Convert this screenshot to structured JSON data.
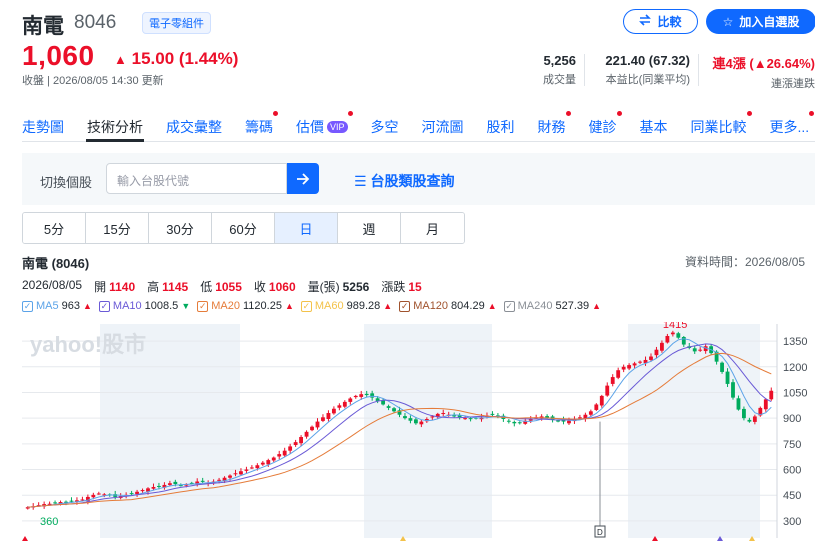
{
  "header": {
    "name": "南電",
    "code": "8046",
    "tag": "電子零組件",
    "compare_label": "比較",
    "watchlist_label": "加入自選股",
    "price": "1,060",
    "change": "15.00 (1.44%)",
    "close_time": "收盤 | 2026/08/05 14:30 更新"
  },
  "stats": [
    {
      "value": "5,256",
      "label": "成交量"
    },
    {
      "value": "221.40 (67.32)",
      "label": "本益比(同業平均)"
    },
    {
      "value": "連4漲 (▲26.64%)",
      "label": "連漲連跌"
    }
  ],
  "tabs": [
    {
      "label": "走勢圖",
      "dot": false
    },
    {
      "label": "技術分析",
      "dot": false
    },
    {
      "label": "成交彙整",
      "dot": false
    },
    {
      "label": "籌碼",
      "dot": true
    },
    {
      "label": "估價",
      "dot": true,
      "vip": "VIP"
    },
    {
      "label": "多空",
      "dot": false
    },
    {
      "label": "河流圖",
      "dot": false
    },
    {
      "label": "股利",
      "dot": false
    },
    {
      "label": "財務",
      "dot": true
    },
    {
      "label": "健診",
      "dot": true
    },
    {
      "label": "基本",
      "dot": false
    },
    {
      "label": "同業比較",
      "dot": true
    },
    {
      "label": "更多...",
      "dot": true
    }
  ],
  "switcher": {
    "label": "切換個股",
    "placeholder": "輸入台股代號",
    "category_link": "台股類股查詢"
  },
  "periods": [
    "5分",
    "15分",
    "30分",
    "60分",
    "日",
    "週",
    "月"
  ],
  "active_period": "日",
  "chart_info": {
    "title": "南電 (8046)",
    "data_time": "資料時間：2026/08/05",
    "date": "2026/08/05",
    "open_label": "開",
    "open": "1140",
    "high_label": "高",
    "high": "1145",
    "low_label": "低",
    "low": "1055",
    "close_label": "收",
    "close": "1060",
    "volume_label": "量(張)",
    "volume": "5256",
    "change_label": "漲跌",
    "change": "15"
  },
  "ma_legend": [
    {
      "name": "MA5",
      "value": "963",
      "dir": "up",
      "color": "#5ba3e8"
    },
    {
      "name": "MA10",
      "value": "1008.5",
      "dir": "down",
      "color": "#6a5ad6"
    },
    {
      "name": "MA20",
      "value": "1120.25",
      "dir": "up",
      "color": "#e57c3a"
    },
    {
      "name": "MA60",
      "value": "989.28",
      "dir": "up",
      "color": "#f3c24a"
    },
    {
      "name": "MA120",
      "value": "804.29",
      "dir": "up",
      "color": "#a0522d"
    },
    {
      "name": "MA240",
      "value": "527.39",
      "dir": "up",
      "color": "#8a8f96"
    }
  ],
  "colors": {
    "up": "#eb0f29",
    "down": "#00ab5e",
    "accent": "#0f69ff"
  },
  "chart_data": {
    "type": "candlestick",
    "watermark": "yahoo!股市",
    "y_ticks": [
      300,
      450,
      600,
      750,
      900,
      1050,
      1200,
      1350
    ],
    "ylim": [
      200,
      1450
    ],
    "annotations": {
      "max_label": "1415",
      "min_label": "360",
      "marker": "D"
    },
    "close_series": [
      380,
      385,
      392,
      398,
      400,
      405,
      410,
      408,
      415,
      420,
      425,
      440,
      452,
      460,
      455,
      448,
      440,
      445,
      452,
      460,
      470,
      480,
      490,
      498,
      502,
      510,
      520,
      515,
      508,
      512,
      520,
      530,
      528,
      522,
      530,
      540,
      552,
      565,
      578,
      590,
      600,
      612,
      625,
      640,
      655,
      670,
      690,
      710,
      735,
      760,
      790,
      820,
      850,
      880,
      905,
      930,
      955,
      975,
      995,
      1015,
      1030,
      1040,
      1035,
      1020,
      1000,
      980,
      960,
      940,
      920,
      900,
      885,
      870,
      880,
      895,
      910,
      925,
      930,
      920,
      910,
      905,
      900,
      895,
      900,
      905,
      915,
      920,
      910,
      895,
      880,
      870,
      875,
      885,
      895,
      905,
      910,
      900,
      890,
      885,
      880,
      885,
      895,
      905,
      920,
      940,
      980,
      1030,
      1090,
      1140,
      1180,
      1200,
      1210,
      1220,
      1230,
      1240,
      1260,
      1300,
      1340,
      1380,
      1400,
      1370,
      1330,
      1310,
      1290,
      1300,
      1320,
      1280,
      1230,
      1170,
      1100,
      1020,
      950,
      900,
      880,
      910,
      960,
      1010,
      1060
    ]
  }
}
